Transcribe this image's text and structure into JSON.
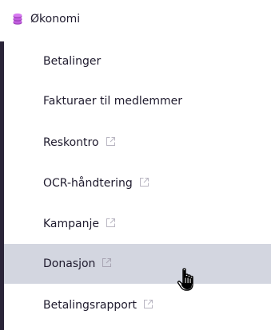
{
  "section": {
    "title": "Økonomi",
    "icon": "coins-stack-icon",
    "icon_color": "#b24fcf"
  },
  "menu": {
    "items": [
      {
        "label": "Betalinger",
        "external": false
      },
      {
        "label": "Fakturaer til medlemmer",
        "external": false
      },
      {
        "label": "Reskontro",
        "external": true
      },
      {
        "label": "OCR-håndtering",
        "external": true
      },
      {
        "label": "Kampanje",
        "external": true
      },
      {
        "label": "Donasjon",
        "external": true,
        "hovered": true
      },
      {
        "label": "Betalingsrapport",
        "external": true
      }
    ],
    "hover_color": "#d3d6e0",
    "active_bar_color": "#2a2438"
  },
  "cursor": "hand-pointer-cursor"
}
